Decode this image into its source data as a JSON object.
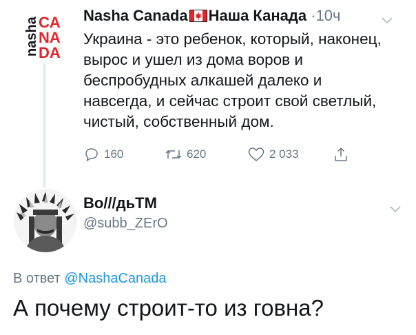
{
  "tweet": {
    "author_name": "Nasha Canada",
    "author_handle": "Наша Канада",
    "separator": "·",
    "time": "10ч",
    "logo_text": "nasha CANADA",
    "text": "Украина - это ребенок, который, наконец, вырос и ушел из дома воров и беспробудных алкашей далеко и навсегда, и сейчас строит свой светлый, чистый, собственный дом.",
    "replies": "160",
    "retweets": "620",
    "likes": "2 033"
  },
  "reply": {
    "author_name": "Bo///дьTM",
    "author_handle": "@subb_ZErO",
    "replying_prefix": "В ответ",
    "replying_to": "@NashaCanada",
    "text": "А почему строит-то из говна?"
  },
  "colors": {
    "text": "#14171a",
    "muted": "#657786",
    "link": "#1b95e0",
    "logo_red": "#e0262b",
    "thread_line": "#e1e8ed"
  }
}
